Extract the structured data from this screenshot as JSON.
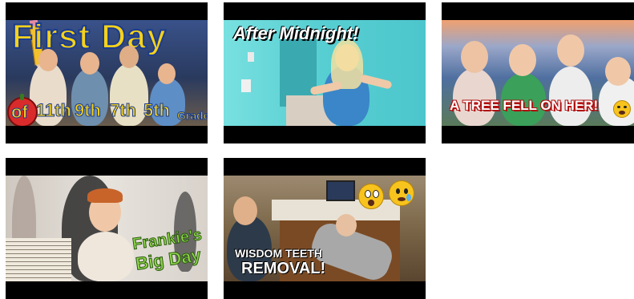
{
  "tiles": [
    {
      "id": "first-day",
      "title_line": "First Day",
      "of_badge": "of",
      "grades": [
        "11th",
        "9th",
        "7th",
        "5th"
      ],
      "grade_word": "Grade"
    },
    {
      "id": "after-midnight",
      "caption": "After Midnight!"
    },
    {
      "id": "tree-fell",
      "caption": "A TREE FELL ON HER!"
    },
    {
      "id": "frankie",
      "caption_line1": "Frankie's",
      "caption_line2": "Big Day"
    },
    {
      "id": "wisdom-teeth",
      "caption_line1": "WISDOM TEETH",
      "caption_line2": "REMOVAL!"
    }
  ],
  "colors": {
    "thumb1_bg": "#2f3f6b",
    "thumb1_text": "#f5d21a",
    "thumb1_outline": "#1b3b8f",
    "thumb2_bg": "#5fd3d6",
    "thumb3_bg": "#6a92c9",
    "thumb4_bg": "#dcd6cf",
    "thumb4_text": "#8fd64a",
    "thumb5_bg": "#7a6a55"
  },
  "icons": [
    "pencil-icon",
    "apple-icon",
    "shocked-emoji-icon",
    "crying-emoji-icon",
    "sob-emoji-icon"
  ]
}
